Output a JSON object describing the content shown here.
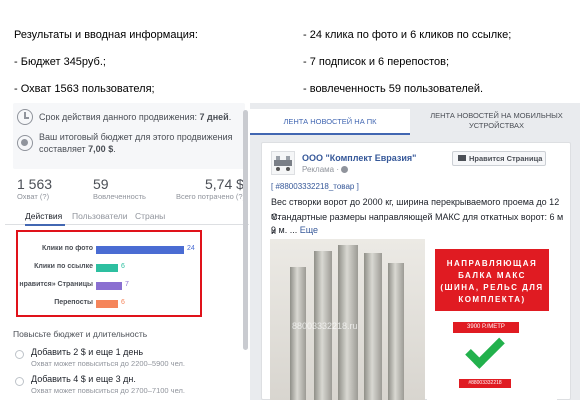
{
  "intro": {
    "left": {
      "title": "Результаты и вводная информация:",
      "budget": "- Бюджет 345руб.;",
      "reach": "- Охват 1563 пользователя;"
    },
    "right": {
      "clicks": "- 24 клика  по фото и 6 кликов по ссылке;",
      "subs": "- 7 подписок и 6 перепостов;",
      "engaged": "- вовлеченность 59 пользователей."
    }
  },
  "promo": {
    "duration_prefix": "Срок действия данного продвижения: ",
    "duration_value": "7 дней",
    "duration_suffix": ".",
    "budget_line1": "Ваш итоговый бюджет для этого продвижения",
    "budget_line2_prefix": "составляет ",
    "budget_value": "7,00 $",
    "budget_line2_suffix": "."
  },
  "stats": [
    {
      "value": "1 563",
      "label": "Охват (?)"
    },
    {
      "value": "59",
      "label": "Вовлеченность"
    },
    {
      "value": "5,74 $",
      "label": "Всего потрачено (?)"
    }
  ],
  "tabs": [
    "Действия",
    "Пользователи",
    "Страны"
  ],
  "chart_data": {
    "type": "bar",
    "categories": [
      "Клики по фото",
      "Клики по ссылке",
      "нравится» Страницы",
      "Перепосты"
    ],
    "values": [
      24,
      6,
      7,
      6
    ],
    "colors": [
      "#4a6cd3",
      "#2dbfa0",
      "#8a6fd1",
      "#f5855b"
    ]
  },
  "budget_section": {
    "heading": "Повысьте бюджет и длительность",
    "options": [
      {
        "title": "Добавить 2 $ и еще 1 день",
        "sub": "Охват может повыситься до 2200–5900 чел."
      },
      {
        "title": "Добавить 4 $ и еще 3 дн.",
        "sub": "Охват может повыситься до 2700–7100 чел."
      }
    ]
  },
  "feed": {
    "tab_pc": "ЛЕНТА НОВОСТЕЙ НА ПК",
    "tab_mobile": "ЛЕНТА НОВОСТЕЙ НА МОБИЛЬНЫХ УСТРОЙСТВАХ"
  },
  "post": {
    "page_name": "ООО \"Комплект Евразия\"",
    "sponsored": "Реклама · ",
    "like_button": "Нравится Страница",
    "hashtag": "[ #88003332218_товар ]",
    "text1": "Вес створки ворот до 2000 кг, ширина перекрываемого проема до 12 м.",
    "text2": "Стандартные размеры направляющей МАКС для откатных ворот: 6 м и",
    "text3": "9 м. ...",
    "more": " Еще",
    "watermark": "88003332218.ru",
    "ad_title": "НАПРАВЛЯЮЩАЯ БАЛКА МАКС (ШИНА, РЕЛЬС ДЛЯ КОМПЛЕКТА)",
    "ad_price": "3900 Р./МЕТР",
    "ad_phone": "#88003332218"
  },
  "icons": [
    "clock-icon",
    "coins-icon",
    "globe-icon",
    "like-icon",
    "checkmark-icon"
  ]
}
